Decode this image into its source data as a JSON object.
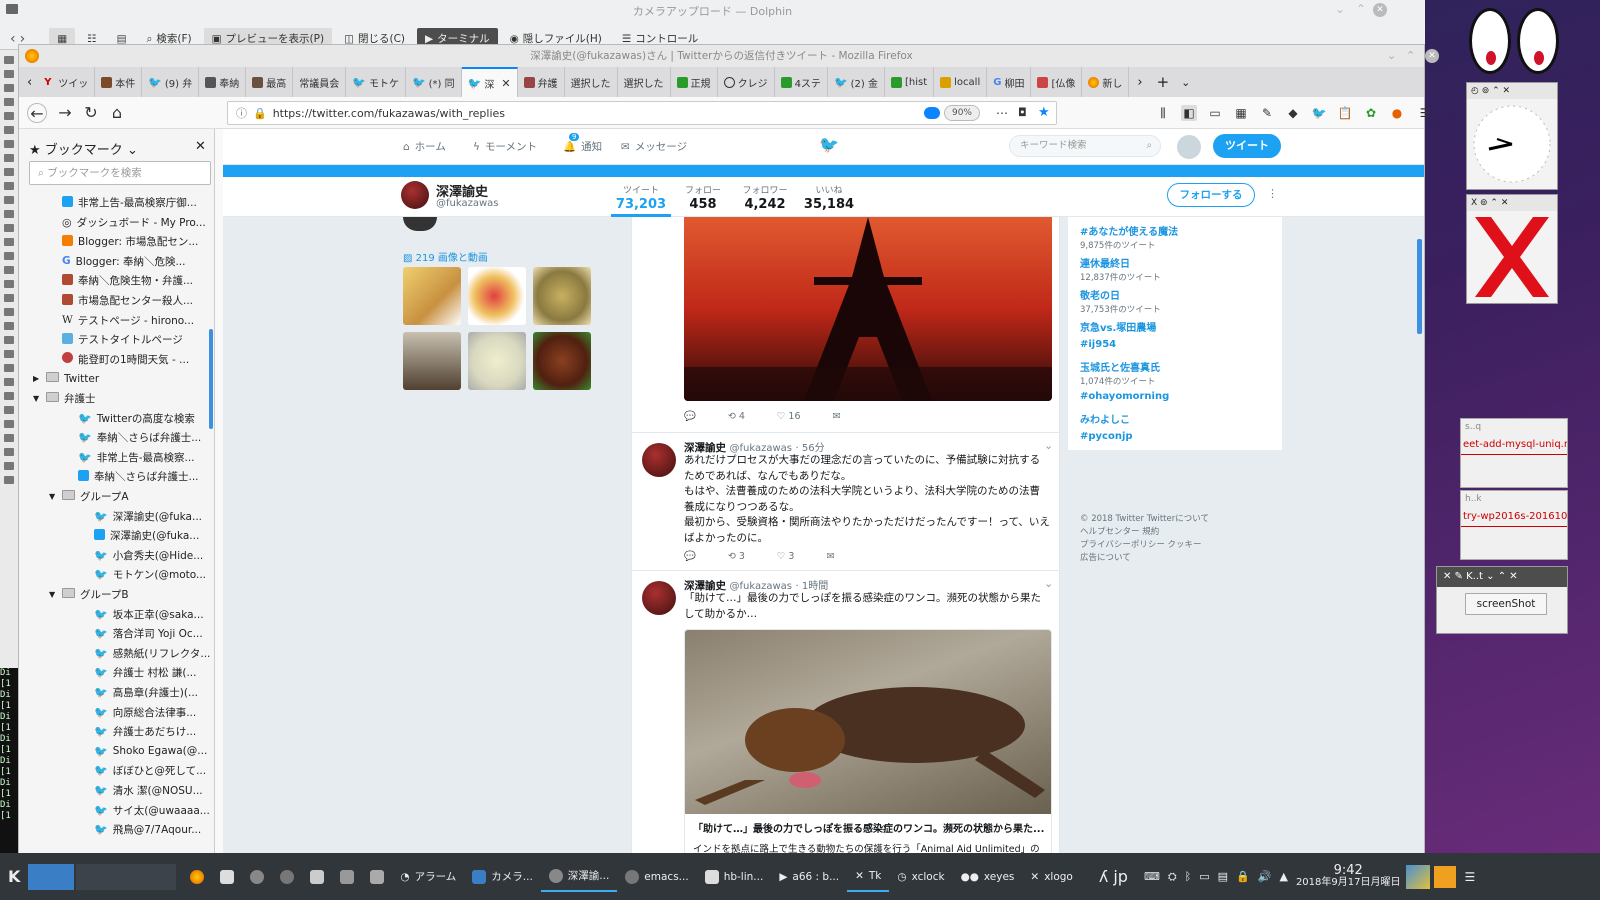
{
  "dolphin": {
    "title": "カメラアップロード — Dolphin",
    "toolbar": [
      "検索(F)",
      "プレビューを表示(P)",
      "閉じる(C)",
      "ターミナル",
      "隠しファイル(H)",
      "コントロール"
    ]
  },
  "firefox": {
    "title": "深澤諭史(@fukazawas)さん | Twitterからの返信付きツイート - Mozilla Firefox",
    "tabs": [
      "ツイッ",
      "本件",
      "(9) 弁",
      "奉納",
      "最高",
      "常議員会",
      "モトケ",
      "(*) 同",
      "深",
      "弁護",
      "選択した",
      "選択した",
      "正規",
      "クレジ",
      "4ステ",
      "(2) 金",
      "[hist",
      "locall",
      "柳田",
      "[仏像",
      "新し"
    ],
    "url": "https://twitter.com/fukazawas/with_replies",
    "zoom": "90%"
  },
  "sidebar": {
    "header": "ブックマーク",
    "search_placeholder": "ブックマークを検索",
    "items": [
      {
        "label": "非常上告-最高検察庁御...",
        "icon": "t-icon",
        "indent": 2
      },
      {
        "label": "ダッシュボード - My Pro...",
        "icon": "globe-icon",
        "indent": 2
      },
      {
        "label": "Blogger: 市場急配セン...",
        "icon": "blogger-icon",
        "indent": 2
      },
      {
        "label": "Blogger: 奉納＼危険...",
        "icon": "google-icon",
        "indent": 2
      },
      {
        "label": "奉納＼危険生物・弁護...",
        "icon": "page-icon",
        "indent": 2
      },
      {
        "label": "市場急配センター殺人...",
        "icon": "page-icon",
        "indent": 2
      },
      {
        "label": "テストページ - hirono...",
        "icon": "wiki-icon",
        "indent": 2
      },
      {
        "label": "テストタイトルページ",
        "icon": "star-icon",
        "indent": 2
      },
      {
        "label": "能登町の1時間天気 - ...",
        "icon": "weather-icon",
        "indent": 2
      },
      {
        "label": "Twitter",
        "icon": "folder-icon",
        "indent": 1,
        "arrow": "▶"
      },
      {
        "label": "弁護士",
        "icon": "folder-icon",
        "indent": 1,
        "arrow": "▼"
      },
      {
        "label": "Twitterの高度な検索",
        "icon": "twitter-icon",
        "indent": 3
      },
      {
        "label": "奉納＼さらば弁護士...",
        "icon": "twitter-icon",
        "indent": 3
      },
      {
        "label": "非常上告-最高検察...",
        "icon": "twitter-icon",
        "indent": 3
      },
      {
        "label": "奉納＼さらば弁護士...",
        "icon": "t-icon",
        "indent": 3
      },
      {
        "label": "グループA",
        "icon": "folder-icon",
        "indent": 2,
        "arrow": "▼"
      },
      {
        "label": "深澤諭史(@fuka...",
        "icon": "twitter-icon",
        "indent": 4
      },
      {
        "label": "深澤諭史(@fuka...",
        "icon": "t-icon",
        "indent": 4
      },
      {
        "label": "小倉秀夫(@Hide...",
        "icon": "twitter-icon",
        "indent": 4
      },
      {
        "label": "モトケン(@moto...",
        "icon": "twitter-icon",
        "indent": 4
      },
      {
        "label": "グループB",
        "icon": "folder-icon",
        "indent": 2,
        "arrow": "▼"
      },
      {
        "label": "坂本正幸(@saka...",
        "icon": "twitter-icon",
        "indent": 4
      },
      {
        "label": "落合洋司 Yoji Oc...",
        "icon": "twitter-icon",
        "indent": 4
      },
      {
        "label": "感熱紙(リフレクタ...",
        "icon": "twitter-icon",
        "indent": 4
      },
      {
        "label": "弁護士 村松 謙(...",
        "icon": "twitter-icon",
        "indent": 4
      },
      {
        "label": "高島章(弁護士)(...",
        "icon": "twitter-icon",
        "indent": 4
      },
      {
        "label": "向原総合法律事...",
        "icon": "twitter-icon",
        "indent": 4
      },
      {
        "label": "弁護士あだちけ...",
        "icon": "twitter-icon",
        "indent": 4
      },
      {
        "label": "Shoko Egawa(@...",
        "icon": "twitter-icon",
        "indent": 4
      },
      {
        "label": "ぼぼひと@死して...",
        "icon": "twitter-icon",
        "indent": 4
      },
      {
        "label": "清水 潔(@NOSU...",
        "icon": "twitter-icon",
        "indent": 4
      },
      {
        "label": "サイ太(@uwaaaa...",
        "icon": "twitter-icon",
        "indent": 4
      },
      {
        "label": "飛鳥@7/7Aqour...",
        "icon": "twitter-icon",
        "indent": 4
      }
    ]
  },
  "twitter": {
    "nav": {
      "home": "ホーム",
      "moments": "モーメント",
      "notifications": "通知",
      "notif_count": "9",
      "messages": "メッセージ",
      "search_placeholder": "キーワード検索",
      "tweet_button": "ツイート"
    },
    "profile": {
      "name": "深澤諭史",
      "handle": "@fukazawas",
      "follow_button": "フォローする",
      "stats": [
        {
          "label": "ツイート",
          "value": "73,203"
        },
        {
          "label": "フォロー",
          "value": "458"
        },
        {
          "label": "フォロワー",
          "value": "4,242"
        },
        {
          "label": "いいね",
          "value": "35,184"
        }
      ],
      "media_link": "219 画像と動画"
    },
    "tweets": [
      {
        "retweets": "4",
        "likes": "16"
      },
      {
        "name": "深澤諭史",
        "handle": "@fukazawas",
        "time": "· 56分",
        "lines": [
          "あれだけプロセスが大事だの理念だの言っていたのに、予備試験に対抗する",
          "ためであれば、なんでもありだな。",
          "もはや、法曹養成のための法科大学院というより、法科大学院のための法曹",
          "養成になりつつあるな。",
          "最初から、受験資格・関所商法やりたかっただけだったんですー！って、いえ",
          "ばよかったのに。"
        ],
        "retweets": "3",
        "likes": "3"
      },
      {
        "name": "深澤諭史",
        "handle": "@fukazawas",
        "time": "· 1時間",
        "lines": [
          "「助けて…」最後の力でしっぽを振る感染症のワンコ。瀕死の状態から果た",
          "して助かるか…"
        ],
        "card_title": "「助けて…」最後の力でしっぽを振る感染症のワンコ。瀕死の状態から果た...",
        "card_sub": "インドを拠点に路上で生きる動物たちの保護を行う「Animal Aid Unlimited」の"
      }
    ],
    "trends": [
      {
        "name": "#あなたが使える魔法",
        "count": "9,875件のツイート"
      },
      {
        "name": "連休最終日",
        "count": "12,837件のツイート"
      },
      {
        "name": "敬老の日",
        "count": "37,753件のツイート"
      },
      {
        "name": "京急vs.塚田農場",
        "count": ""
      },
      {
        "name": "#ij954",
        "count": ""
      },
      {
        "name": "玉城氏と佐喜真氏",
        "count": "1,074件のツイート"
      },
      {
        "name": "#ohayomorning",
        "count": ""
      },
      {
        "name": "みわよしこ",
        "count": ""
      },
      {
        "name": "#pyconjp",
        "count": ""
      }
    ],
    "footer": [
      "© 2018 Twitter  Twitterについて",
      "ヘルプセンター  規約",
      "プライバシーポリシー  クッキー",
      "広告について"
    ]
  },
  "widgets": {
    "mini1": "s..q",
    "mini1_text": "eet-add-mysql-uniq.r",
    "mini2": "h..k",
    "mini2_text": "try-wp2016s-201610",
    "tk_title": "K..t",
    "tk_button": "screenShot"
  },
  "taskbar": {
    "items": [
      "アラーム",
      "カメラ...",
      "深澤諭...",
      "emacs...",
      "hb-lin...",
      "a66 : b...",
      "Tk",
      "xclock",
      "xeyes",
      "xlogo"
    ],
    "lang": "jp",
    "time": "9:42",
    "date": "2018年9月17日月曜日"
  },
  "colors": {
    "twitter_blue": "#1da1f2",
    "taskbar": "#31363b",
    "firefox_accent": "#0a84ff"
  }
}
